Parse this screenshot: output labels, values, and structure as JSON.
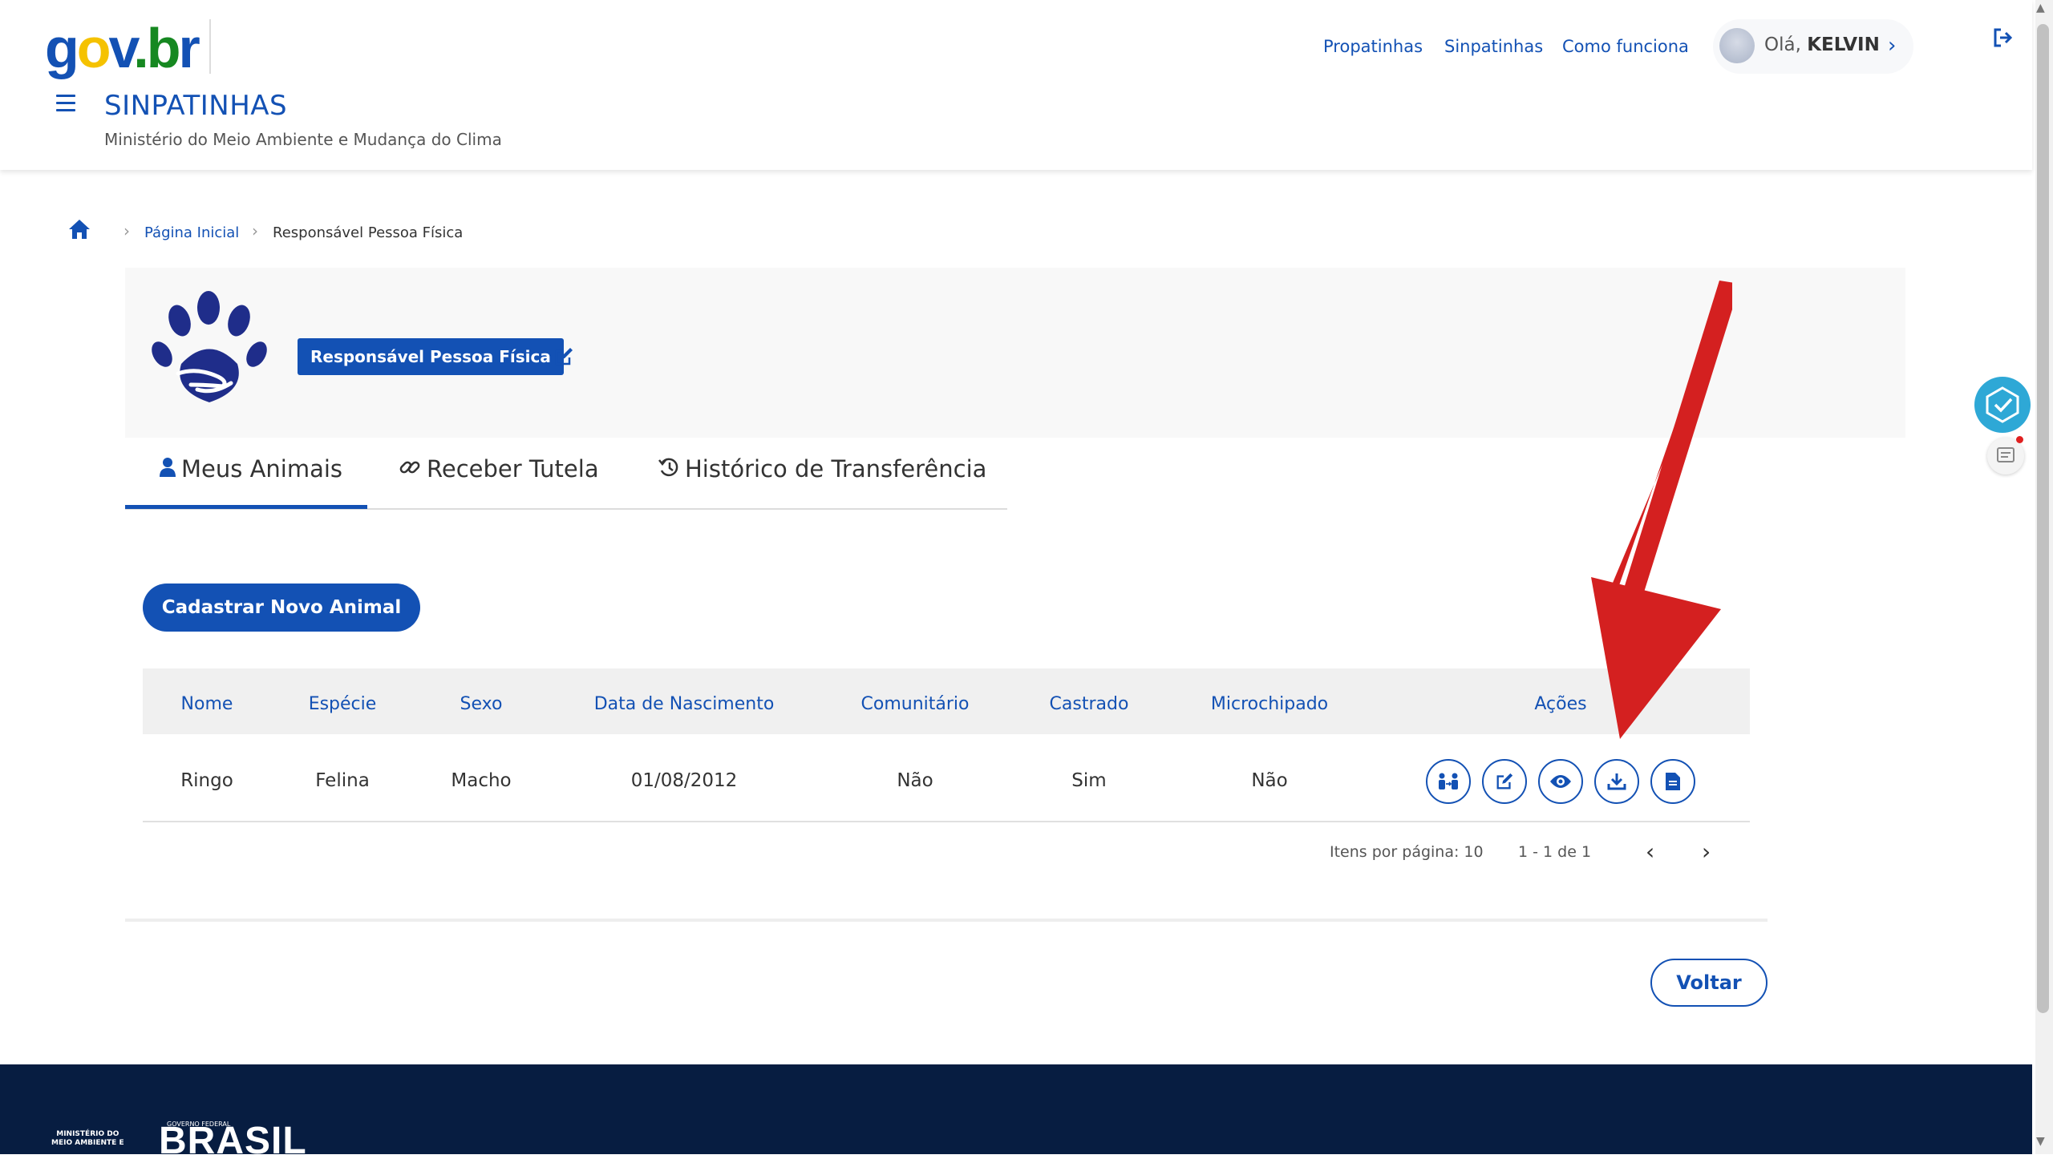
{
  "header": {
    "logo": {
      "g": "g",
      "o": "o",
      "v": "v",
      "b": ".b",
      "r": "r"
    },
    "system_title": "SINPATINHAS",
    "system_subtitle": "Ministério do Meio Ambiente e Mudança do Clima",
    "links": [
      "Propatinhas",
      "Sinpatinhas",
      "Como funciona"
    ],
    "greeting": "Olá,",
    "user_name": "KELVIN"
  },
  "breadcrumb": {
    "items": [
      "Página Inicial",
      "Responsável Pessoa Física"
    ]
  },
  "profile": {
    "role_label": "Responsável Pessoa Física"
  },
  "tabs": [
    {
      "label": "Meus Animais",
      "icon": "person-icon",
      "active": true
    },
    {
      "label": "Receber Tutela",
      "icon": "link-icon",
      "active": false
    },
    {
      "label": "Histórico de Transferência",
      "icon": "history-icon",
      "active": false
    }
  ],
  "add_button_label": "Cadastrar Novo Animal",
  "table": {
    "columns": [
      "Nome",
      "Espécie",
      "Sexo",
      "Data de Nascimento",
      "Comunitário",
      "Castrado",
      "Microchipado",
      "Ações"
    ],
    "rows": [
      [
        "Ringo",
        "Felina",
        "Macho",
        "01/08/2012",
        "Não",
        "Sim",
        "Não"
      ]
    ],
    "actions": [
      "transfer-icon",
      "edit-icon",
      "view-icon",
      "download-icon",
      "document-icon"
    ]
  },
  "pagination": {
    "items_per_page": "Itens por página: 10",
    "range": "1 - 1 de 1"
  },
  "back_button_label": "Voltar",
  "footer": {
    "ministry": "MINISTÉRIO DO\nMEIO AMBIENTE E",
    "government": "GOVERNO FEDERAL",
    "brasil": "BRASIL"
  },
  "colors": {
    "primary": "#1351b4",
    "footer_bg": "#071d41",
    "arrow": "#d42020"
  }
}
